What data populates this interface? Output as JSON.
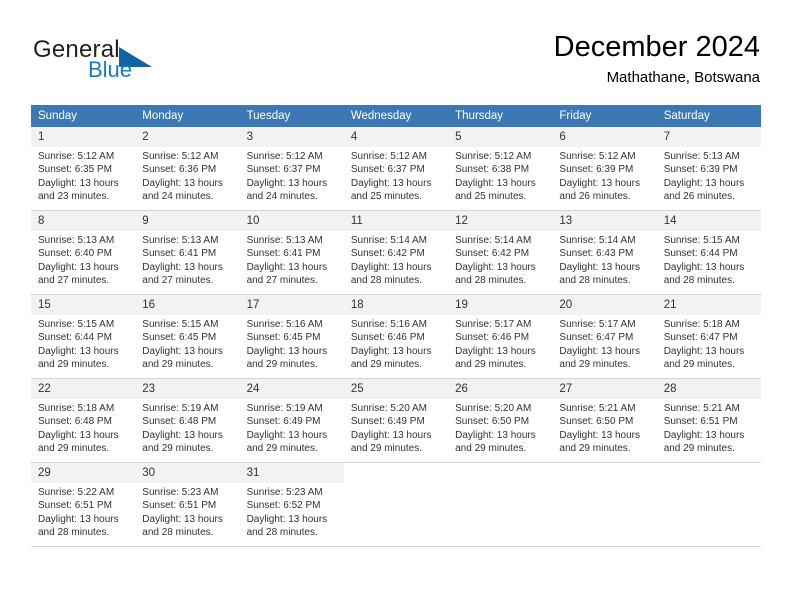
{
  "brand": {
    "name_part1": "General",
    "name_part2": "Blue",
    "flag_icon": "triangle-flag-icon"
  },
  "header": {
    "title": "December 2024",
    "location": "Mathathane, Botswana"
  },
  "colors": {
    "header_blue": "#3c79b4",
    "brand_blue": "#1b79c4",
    "daynum_bg": "#f2f2f2",
    "grid_line": "#d4d4d4"
  },
  "weekday_headers": [
    "Sunday",
    "Monday",
    "Tuesday",
    "Wednesday",
    "Thursday",
    "Friday",
    "Saturday"
  ],
  "labels": {
    "sunrise_prefix": "Sunrise:",
    "sunset_prefix": "Sunset:",
    "daylight_prefix": "Daylight:"
  },
  "weeks": [
    [
      {
        "day": "1",
        "sunrise": "Sunrise: 5:12 AM",
        "sunset": "Sunset: 6:35 PM",
        "daylight_line1": "Daylight: 13 hours",
        "daylight_line2": "and 23 minutes."
      },
      {
        "day": "2",
        "sunrise": "Sunrise: 5:12 AM",
        "sunset": "Sunset: 6:36 PM",
        "daylight_line1": "Daylight: 13 hours",
        "daylight_line2": "and 24 minutes."
      },
      {
        "day": "3",
        "sunrise": "Sunrise: 5:12 AM",
        "sunset": "Sunset: 6:37 PM",
        "daylight_line1": "Daylight: 13 hours",
        "daylight_line2": "and 24 minutes."
      },
      {
        "day": "4",
        "sunrise": "Sunrise: 5:12 AM",
        "sunset": "Sunset: 6:37 PM",
        "daylight_line1": "Daylight: 13 hours",
        "daylight_line2": "and 25 minutes."
      },
      {
        "day": "5",
        "sunrise": "Sunrise: 5:12 AM",
        "sunset": "Sunset: 6:38 PM",
        "daylight_line1": "Daylight: 13 hours",
        "daylight_line2": "and 25 minutes."
      },
      {
        "day": "6",
        "sunrise": "Sunrise: 5:12 AM",
        "sunset": "Sunset: 6:39 PM",
        "daylight_line1": "Daylight: 13 hours",
        "daylight_line2": "and 26 minutes."
      },
      {
        "day": "7",
        "sunrise": "Sunrise: 5:13 AM",
        "sunset": "Sunset: 6:39 PM",
        "daylight_line1": "Daylight: 13 hours",
        "daylight_line2": "and 26 minutes."
      }
    ],
    [
      {
        "day": "8",
        "sunrise": "Sunrise: 5:13 AM",
        "sunset": "Sunset: 6:40 PM",
        "daylight_line1": "Daylight: 13 hours",
        "daylight_line2": "and 27 minutes."
      },
      {
        "day": "9",
        "sunrise": "Sunrise: 5:13 AM",
        "sunset": "Sunset: 6:41 PM",
        "daylight_line1": "Daylight: 13 hours",
        "daylight_line2": "and 27 minutes."
      },
      {
        "day": "10",
        "sunrise": "Sunrise: 5:13 AM",
        "sunset": "Sunset: 6:41 PM",
        "daylight_line1": "Daylight: 13 hours",
        "daylight_line2": "and 27 minutes."
      },
      {
        "day": "11",
        "sunrise": "Sunrise: 5:14 AM",
        "sunset": "Sunset: 6:42 PM",
        "daylight_line1": "Daylight: 13 hours",
        "daylight_line2": "and 28 minutes."
      },
      {
        "day": "12",
        "sunrise": "Sunrise: 5:14 AM",
        "sunset": "Sunset: 6:42 PM",
        "daylight_line1": "Daylight: 13 hours",
        "daylight_line2": "and 28 minutes."
      },
      {
        "day": "13",
        "sunrise": "Sunrise: 5:14 AM",
        "sunset": "Sunset: 6:43 PM",
        "daylight_line1": "Daylight: 13 hours",
        "daylight_line2": "and 28 minutes."
      },
      {
        "day": "14",
        "sunrise": "Sunrise: 5:15 AM",
        "sunset": "Sunset: 6:44 PM",
        "daylight_line1": "Daylight: 13 hours",
        "daylight_line2": "and 28 minutes."
      }
    ],
    [
      {
        "day": "15",
        "sunrise": "Sunrise: 5:15 AM",
        "sunset": "Sunset: 6:44 PM",
        "daylight_line1": "Daylight: 13 hours",
        "daylight_line2": "and 29 minutes."
      },
      {
        "day": "16",
        "sunrise": "Sunrise: 5:15 AM",
        "sunset": "Sunset: 6:45 PM",
        "daylight_line1": "Daylight: 13 hours",
        "daylight_line2": "and 29 minutes."
      },
      {
        "day": "17",
        "sunrise": "Sunrise: 5:16 AM",
        "sunset": "Sunset: 6:45 PM",
        "daylight_line1": "Daylight: 13 hours",
        "daylight_line2": "and 29 minutes."
      },
      {
        "day": "18",
        "sunrise": "Sunrise: 5:16 AM",
        "sunset": "Sunset: 6:46 PM",
        "daylight_line1": "Daylight: 13 hours",
        "daylight_line2": "and 29 minutes."
      },
      {
        "day": "19",
        "sunrise": "Sunrise: 5:17 AM",
        "sunset": "Sunset: 6:46 PM",
        "daylight_line1": "Daylight: 13 hours",
        "daylight_line2": "and 29 minutes."
      },
      {
        "day": "20",
        "sunrise": "Sunrise: 5:17 AM",
        "sunset": "Sunset: 6:47 PM",
        "daylight_line1": "Daylight: 13 hours",
        "daylight_line2": "and 29 minutes."
      },
      {
        "day": "21",
        "sunrise": "Sunrise: 5:18 AM",
        "sunset": "Sunset: 6:47 PM",
        "daylight_line1": "Daylight: 13 hours",
        "daylight_line2": "and 29 minutes."
      }
    ],
    [
      {
        "day": "22",
        "sunrise": "Sunrise: 5:18 AM",
        "sunset": "Sunset: 6:48 PM",
        "daylight_line1": "Daylight: 13 hours",
        "daylight_line2": "and 29 minutes."
      },
      {
        "day": "23",
        "sunrise": "Sunrise: 5:19 AM",
        "sunset": "Sunset: 6:48 PM",
        "daylight_line1": "Daylight: 13 hours",
        "daylight_line2": "and 29 minutes."
      },
      {
        "day": "24",
        "sunrise": "Sunrise: 5:19 AM",
        "sunset": "Sunset: 6:49 PM",
        "daylight_line1": "Daylight: 13 hours",
        "daylight_line2": "and 29 minutes."
      },
      {
        "day": "25",
        "sunrise": "Sunrise: 5:20 AM",
        "sunset": "Sunset: 6:49 PM",
        "daylight_line1": "Daylight: 13 hours",
        "daylight_line2": "and 29 minutes."
      },
      {
        "day": "26",
        "sunrise": "Sunrise: 5:20 AM",
        "sunset": "Sunset: 6:50 PM",
        "daylight_line1": "Daylight: 13 hours",
        "daylight_line2": "and 29 minutes."
      },
      {
        "day": "27",
        "sunrise": "Sunrise: 5:21 AM",
        "sunset": "Sunset: 6:50 PM",
        "daylight_line1": "Daylight: 13 hours",
        "daylight_line2": "and 29 minutes."
      },
      {
        "day": "28",
        "sunrise": "Sunrise: 5:21 AM",
        "sunset": "Sunset: 6:51 PM",
        "daylight_line1": "Daylight: 13 hours",
        "daylight_line2": "and 29 minutes."
      }
    ],
    [
      {
        "day": "29",
        "sunrise": "Sunrise: 5:22 AM",
        "sunset": "Sunset: 6:51 PM",
        "daylight_line1": "Daylight: 13 hours",
        "daylight_line2": "and 28 minutes."
      },
      {
        "day": "30",
        "sunrise": "Sunrise: 5:23 AM",
        "sunset": "Sunset: 6:51 PM",
        "daylight_line1": "Daylight: 13 hours",
        "daylight_line2": "and 28 minutes."
      },
      {
        "day": "31",
        "sunrise": "Sunrise: 5:23 AM",
        "sunset": "Sunset: 6:52 PM",
        "daylight_line1": "Daylight: 13 hours",
        "daylight_line2": "and 28 minutes."
      },
      {
        "day": "",
        "sunrise": "",
        "sunset": "",
        "daylight_line1": "",
        "daylight_line2": ""
      },
      {
        "day": "",
        "sunrise": "",
        "sunset": "",
        "daylight_line1": "",
        "daylight_line2": ""
      },
      {
        "day": "",
        "sunrise": "",
        "sunset": "",
        "daylight_line1": "",
        "daylight_line2": ""
      },
      {
        "day": "",
        "sunrise": "",
        "sunset": "",
        "daylight_line1": "",
        "daylight_line2": ""
      }
    ]
  ]
}
